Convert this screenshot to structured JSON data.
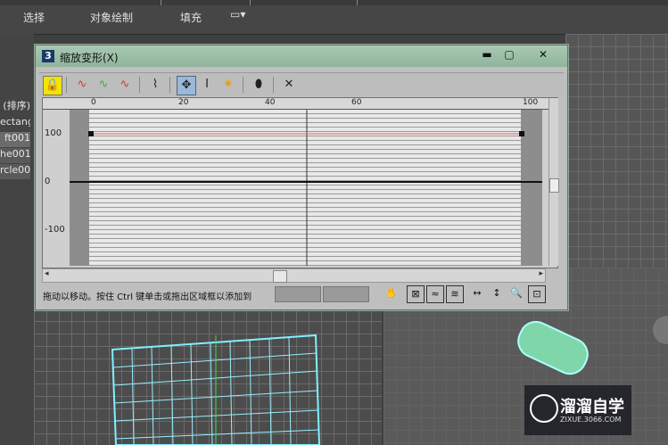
{
  "menu": {
    "select": "选择",
    "object_paint": "对象绘制",
    "fill": "填充"
  },
  "left_list": {
    "header": "(排序)",
    "items": [
      "ectang",
      "ft001",
      "he001",
      "rcle00"
    ]
  },
  "dialog": {
    "icon_label": "3",
    "title": "缩放变形(X)",
    "ruler_ticks": [
      "0",
      "20",
      "40",
      "60",
      "100"
    ],
    "y_labels": [
      "100",
      "0",
      "-100"
    ],
    "status": "拖动以移动。按住 Ctrl 键单击或拖出区域框以添加到"
  },
  "watermark": {
    "title": "溜溜自学",
    "subtitle": "ZIXUE.3066.COM"
  }
}
